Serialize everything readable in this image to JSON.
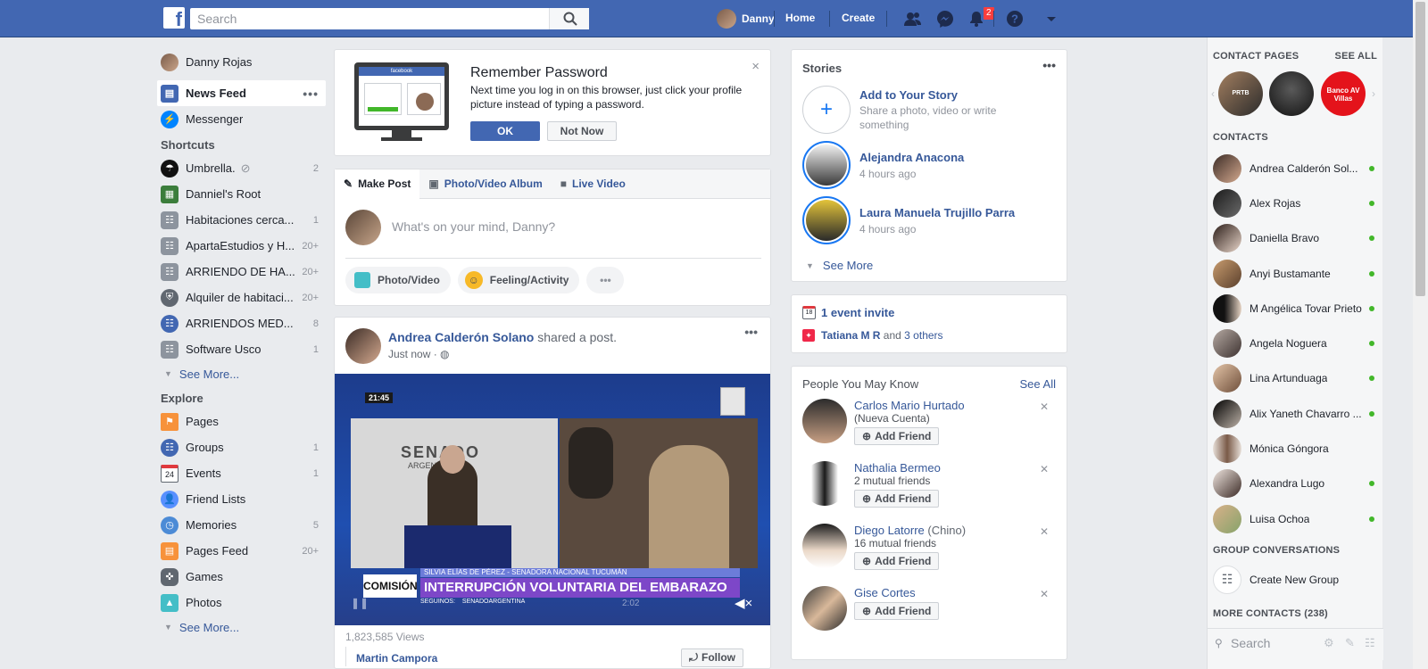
{
  "header": {
    "search_placeholder": "Search",
    "user": "Danny",
    "home": "Home",
    "create": "Create",
    "notif_count": "2"
  },
  "left": {
    "profile": "Danny Rojas",
    "news_feed": "News Feed",
    "messenger": "Messenger",
    "shortcuts_title": "Shortcuts",
    "shortcuts": [
      {
        "label": "Umbrella.",
        "count": "2"
      },
      {
        "label": "Danniel's Root",
        "count": ""
      },
      {
        "label": "Habitaciones cerca...",
        "count": "1"
      },
      {
        "label": "ApartaEstudios y H...",
        "count": "20+"
      },
      {
        "label": "ARRIENDO DE HA...",
        "count": "20+"
      },
      {
        "label": "Alquiler de habitaci...",
        "count": "20+"
      },
      {
        "label": "ARRIENDOS MED...",
        "count": "8"
      },
      {
        "label": "Software Usco",
        "count": "1"
      }
    ],
    "see_more": "See More...",
    "explore_title": "Explore",
    "explore": [
      {
        "label": "Pages",
        "count": ""
      },
      {
        "label": "Groups",
        "count": "1"
      },
      {
        "label": "Events",
        "count": "1"
      },
      {
        "label": "Friend Lists",
        "count": ""
      },
      {
        "label": "Memories",
        "count": "5"
      },
      {
        "label": "Pages Feed",
        "count": "20+"
      },
      {
        "label": "Games",
        "count": ""
      },
      {
        "label": "Photos",
        "count": ""
      }
    ],
    "see_more2": "See More..."
  },
  "remember": {
    "title": "Remember Password",
    "body": "Next time you log in on this browser, just click your profile picture instead of typing a password.",
    "ok": "OK",
    "not_now": "Not Now",
    "logo": "facebook"
  },
  "composer": {
    "make_post": "Make Post",
    "album": "Photo/Video Album",
    "live": "Live Video",
    "placeholder": "What's on your mind, Danny?",
    "photo": "Photo/Video",
    "feeling": "Feeling/Activity"
  },
  "post": {
    "author": "Andrea Calderón Solano",
    "action": "shared a post.",
    "time": "Just now ·",
    "time_badge": "21:45",
    "banner_tag": "COMISIÓN",
    "banner_sub": "SILVIA ELÍAS DE PÉREZ - SENADORA NACIONAL TUCUMÁN",
    "banner_main": "INTERRUPCIÓN VOLUNTARIA DEL EMBARAZO",
    "banner_follow": "SEGUINOS:",
    "banner_handle": "SENADOARGENTINA",
    "senado": "SENADO",
    "argentina": "ARGENTINA",
    "video_time": "2:02",
    "views": "1,823,585 Views",
    "shared_from": "Martin Campora",
    "follow": "Follow"
  },
  "stories": {
    "title": "Stories",
    "add_title": "Add to Your Story",
    "add_sub": "Share a photo, video or write something",
    "items": [
      {
        "name": "Alejandra Anacona",
        "time": "4 hours ago"
      },
      {
        "name": "Laura Manuela Trujillo Parra",
        "time": "4 hours ago"
      }
    ],
    "see_more": "See More"
  },
  "events": {
    "invite": "1 event invite",
    "day": "18",
    "person": "Tatiana M R",
    "and": "and",
    "others": "3 others"
  },
  "pymk": {
    "title": "People You May Know",
    "see_all": "See All",
    "add": "Add Friend",
    "people": [
      {
        "name": "Carlos Mario Hurtado",
        "extra": "",
        "sub": "(Nueva Cuenta)"
      },
      {
        "name": "Nathalia Bermeo",
        "extra": "",
        "sub": "2 mutual friends"
      },
      {
        "name": "Diego Latorre",
        "extra": "(Chino)",
        "sub": "16 mutual friends"
      },
      {
        "name": "Gise Cortes",
        "extra": "",
        "sub": ""
      }
    ]
  },
  "chat": {
    "contact_pages": "CONTACT PAGES",
    "see_all": "SEE ALL",
    "page_labels": [
      "PRTB",
      "",
      "Banco AV Villas"
    ],
    "contacts_title": "CONTACTS",
    "contacts": [
      "Andrea Calderón Sol...",
      "Alex Rojas",
      "Daniella Bravo",
      "Anyi Bustamante",
      "M Angélica Tovar Prieto",
      "Angela Noguera",
      "Lina Artunduaga",
      "Alix Yaneth Chavarro ...",
      "Mónica Góngora",
      "Alexandra Lugo",
      "Luisa Ochoa"
    ],
    "online": [
      true,
      true,
      true,
      true,
      true,
      true,
      true,
      true,
      false,
      true,
      true
    ],
    "group_conv": "GROUP CONVERSATIONS",
    "create_group": "Create New Group",
    "more_contacts": "MORE CONTACTS (238)",
    "search": "Search"
  }
}
